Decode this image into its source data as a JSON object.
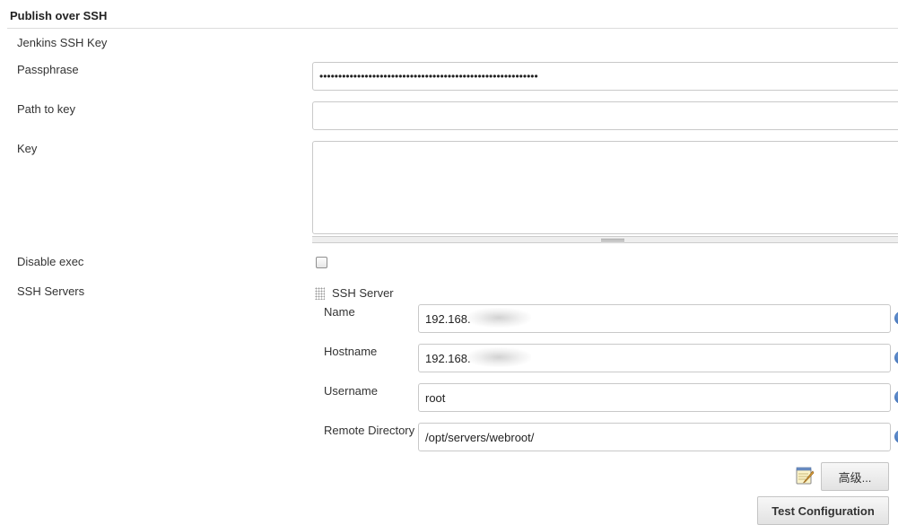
{
  "section": {
    "title": "Publish over SSH"
  },
  "jenkins_ssh_key": {
    "heading": "Jenkins SSH Key",
    "passphrase_label": "Passphrase",
    "passphrase_value": "••••••••••••••••••••••••••••••••••••••••••••••••••••••••••",
    "path_label": "Path to key",
    "path_value": "",
    "key_label": "Key",
    "key_value": ""
  },
  "disable_exec": {
    "label": "Disable exec",
    "checked": false
  },
  "ssh_servers": {
    "label": "SSH Servers",
    "server": {
      "header": "SSH Server",
      "name_label": "Name",
      "name_value": "192.168.",
      "hostname_label": "Hostname",
      "hostname_value": "192.168.",
      "username_label": "Username",
      "username_value": "root",
      "remote_dir_label": "Remote Directory",
      "remote_dir_value": "/opt/servers/webroot/"
    }
  },
  "buttons": {
    "advanced": "高级...",
    "test_configuration": "Test Configuration"
  },
  "icons": {
    "help": "help-icon",
    "drag": "drag-handle-icon",
    "notepad": "notepad-icon"
  },
  "colors": {
    "help_icon": "#2f5fa8",
    "border": "#c9c9c9"
  }
}
